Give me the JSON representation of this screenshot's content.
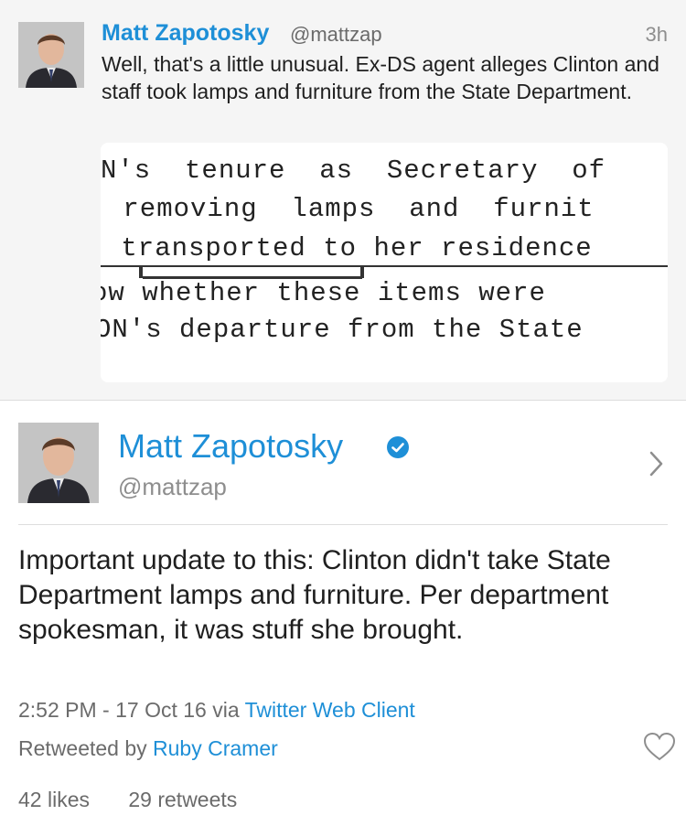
{
  "quoted_tweet": {
    "name": "Matt Zapotosky",
    "handle": "@mattzap",
    "time": "3h",
    "text": "Well, that's a little unusual. Ex-DS agent alleges Clinton and staff took lamps and furniture from the State Department.",
    "document_lines": [
      "N's  tenure  as  Secretary  of",
      " removing  lamps  and  furnit",
      " transported to her residence",
      "ow whether these items were",
      "ON's departure from the State"
    ]
  },
  "main_tweet": {
    "name": "Matt Zapotosky",
    "handle": "@mattzap",
    "verified": true,
    "text": "Important update to this: Clinton didn't take State Department lamps and furniture. Per department spokesman, it was stuff she brought.",
    "timestamp": "2:52 PM - 17 Oct 16",
    "via_label": "via",
    "client": "Twitter Web Client",
    "retweeted_by_label": "Retweeted by",
    "retweeted_by": "Ruby Cramer",
    "likes": "42 likes",
    "retweets": "29 retweets"
  },
  "icons": {
    "verified": "verified-badge-icon",
    "chevron": "chevron-right-icon",
    "like": "heart-icon"
  },
  "colors": {
    "link": "#1e8fd7",
    "secondary_text": "#6b6b6b",
    "quoted_background": "#f5f5f5"
  }
}
